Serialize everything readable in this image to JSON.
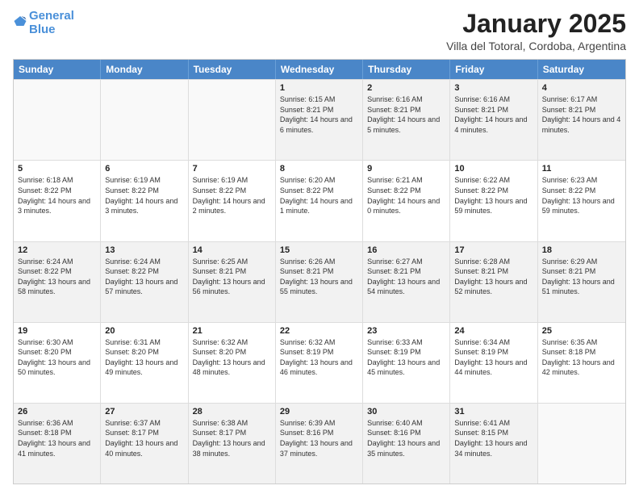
{
  "header": {
    "logo_line1": "General",
    "logo_line2": "Blue",
    "month": "January 2025",
    "location": "Villa del Totoral, Cordoba, Argentina"
  },
  "days_of_week": [
    "Sunday",
    "Monday",
    "Tuesday",
    "Wednesday",
    "Thursday",
    "Friday",
    "Saturday"
  ],
  "weeks": [
    [
      {
        "day": "",
        "sunrise": "",
        "sunset": "",
        "daylight": "",
        "empty": true
      },
      {
        "day": "",
        "sunrise": "",
        "sunset": "",
        "daylight": "",
        "empty": true
      },
      {
        "day": "",
        "sunrise": "",
        "sunset": "",
        "daylight": "",
        "empty": true
      },
      {
        "day": "1",
        "sunrise": "Sunrise: 6:15 AM",
        "sunset": "Sunset: 8:21 PM",
        "daylight": "Daylight: 14 hours and 6 minutes."
      },
      {
        "day": "2",
        "sunrise": "Sunrise: 6:16 AM",
        "sunset": "Sunset: 8:21 PM",
        "daylight": "Daylight: 14 hours and 5 minutes."
      },
      {
        "day": "3",
        "sunrise": "Sunrise: 6:16 AM",
        "sunset": "Sunset: 8:21 PM",
        "daylight": "Daylight: 14 hours and 4 minutes."
      },
      {
        "day": "4",
        "sunrise": "Sunrise: 6:17 AM",
        "sunset": "Sunset: 8:21 PM",
        "daylight": "Daylight: 14 hours and 4 minutes."
      }
    ],
    [
      {
        "day": "5",
        "sunrise": "Sunrise: 6:18 AM",
        "sunset": "Sunset: 8:22 PM",
        "daylight": "Daylight: 14 hours and 3 minutes."
      },
      {
        "day": "6",
        "sunrise": "Sunrise: 6:19 AM",
        "sunset": "Sunset: 8:22 PM",
        "daylight": "Daylight: 14 hours and 3 minutes."
      },
      {
        "day": "7",
        "sunrise": "Sunrise: 6:19 AM",
        "sunset": "Sunset: 8:22 PM",
        "daylight": "Daylight: 14 hours and 2 minutes."
      },
      {
        "day": "8",
        "sunrise": "Sunrise: 6:20 AM",
        "sunset": "Sunset: 8:22 PM",
        "daylight": "Daylight: 14 hours and 1 minute."
      },
      {
        "day": "9",
        "sunrise": "Sunrise: 6:21 AM",
        "sunset": "Sunset: 8:22 PM",
        "daylight": "Daylight: 14 hours and 0 minutes."
      },
      {
        "day": "10",
        "sunrise": "Sunrise: 6:22 AM",
        "sunset": "Sunset: 8:22 PM",
        "daylight": "Daylight: 13 hours and 59 minutes."
      },
      {
        "day": "11",
        "sunrise": "Sunrise: 6:23 AM",
        "sunset": "Sunset: 8:22 PM",
        "daylight": "Daylight: 13 hours and 59 minutes."
      }
    ],
    [
      {
        "day": "12",
        "sunrise": "Sunrise: 6:24 AM",
        "sunset": "Sunset: 8:22 PM",
        "daylight": "Daylight: 13 hours and 58 minutes."
      },
      {
        "day": "13",
        "sunrise": "Sunrise: 6:24 AM",
        "sunset": "Sunset: 8:22 PM",
        "daylight": "Daylight: 13 hours and 57 minutes."
      },
      {
        "day": "14",
        "sunrise": "Sunrise: 6:25 AM",
        "sunset": "Sunset: 8:21 PM",
        "daylight": "Daylight: 13 hours and 56 minutes."
      },
      {
        "day": "15",
        "sunrise": "Sunrise: 6:26 AM",
        "sunset": "Sunset: 8:21 PM",
        "daylight": "Daylight: 13 hours and 55 minutes."
      },
      {
        "day": "16",
        "sunrise": "Sunrise: 6:27 AM",
        "sunset": "Sunset: 8:21 PM",
        "daylight": "Daylight: 13 hours and 54 minutes."
      },
      {
        "day": "17",
        "sunrise": "Sunrise: 6:28 AM",
        "sunset": "Sunset: 8:21 PM",
        "daylight": "Daylight: 13 hours and 52 minutes."
      },
      {
        "day": "18",
        "sunrise": "Sunrise: 6:29 AM",
        "sunset": "Sunset: 8:21 PM",
        "daylight": "Daylight: 13 hours and 51 minutes."
      }
    ],
    [
      {
        "day": "19",
        "sunrise": "Sunrise: 6:30 AM",
        "sunset": "Sunset: 8:20 PM",
        "daylight": "Daylight: 13 hours and 50 minutes."
      },
      {
        "day": "20",
        "sunrise": "Sunrise: 6:31 AM",
        "sunset": "Sunset: 8:20 PM",
        "daylight": "Daylight: 13 hours and 49 minutes."
      },
      {
        "day": "21",
        "sunrise": "Sunrise: 6:32 AM",
        "sunset": "Sunset: 8:20 PM",
        "daylight": "Daylight: 13 hours and 48 minutes."
      },
      {
        "day": "22",
        "sunrise": "Sunrise: 6:32 AM",
        "sunset": "Sunset: 8:19 PM",
        "daylight": "Daylight: 13 hours and 46 minutes."
      },
      {
        "day": "23",
        "sunrise": "Sunrise: 6:33 AM",
        "sunset": "Sunset: 8:19 PM",
        "daylight": "Daylight: 13 hours and 45 minutes."
      },
      {
        "day": "24",
        "sunrise": "Sunrise: 6:34 AM",
        "sunset": "Sunset: 8:19 PM",
        "daylight": "Daylight: 13 hours and 44 minutes."
      },
      {
        "day": "25",
        "sunrise": "Sunrise: 6:35 AM",
        "sunset": "Sunset: 8:18 PM",
        "daylight": "Daylight: 13 hours and 42 minutes."
      }
    ],
    [
      {
        "day": "26",
        "sunrise": "Sunrise: 6:36 AM",
        "sunset": "Sunset: 8:18 PM",
        "daylight": "Daylight: 13 hours and 41 minutes."
      },
      {
        "day": "27",
        "sunrise": "Sunrise: 6:37 AM",
        "sunset": "Sunset: 8:17 PM",
        "daylight": "Daylight: 13 hours and 40 minutes."
      },
      {
        "day": "28",
        "sunrise": "Sunrise: 6:38 AM",
        "sunset": "Sunset: 8:17 PM",
        "daylight": "Daylight: 13 hours and 38 minutes."
      },
      {
        "day": "29",
        "sunrise": "Sunrise: 6:39 AM",
        "sunset": "Sunset: 8:16 PM",
        "daylight": "Daylight: 13 hours and 37 minutes."
      },
      {
        "day": "30",
        "sunrise": "Sunrise: 6:40 AM",
        "sunset": "Sunset: 8:16 PM",
        "daylight": "Daylight: 13 hours and 35 minutes."
      },
      {
        "day": "31",
        "sunrise": "Sunrise: 6:41 AM",
        "sunset": "Sunset: 8:15 PM",
        "daylight": "Daylight: 13 hours and 34 minutes."
      },
      {
        "day": "",
        "sunrise": "",
        "sunset": "",
        "daylight": "",
        "empty": true
      }
    ]
  ]
}
